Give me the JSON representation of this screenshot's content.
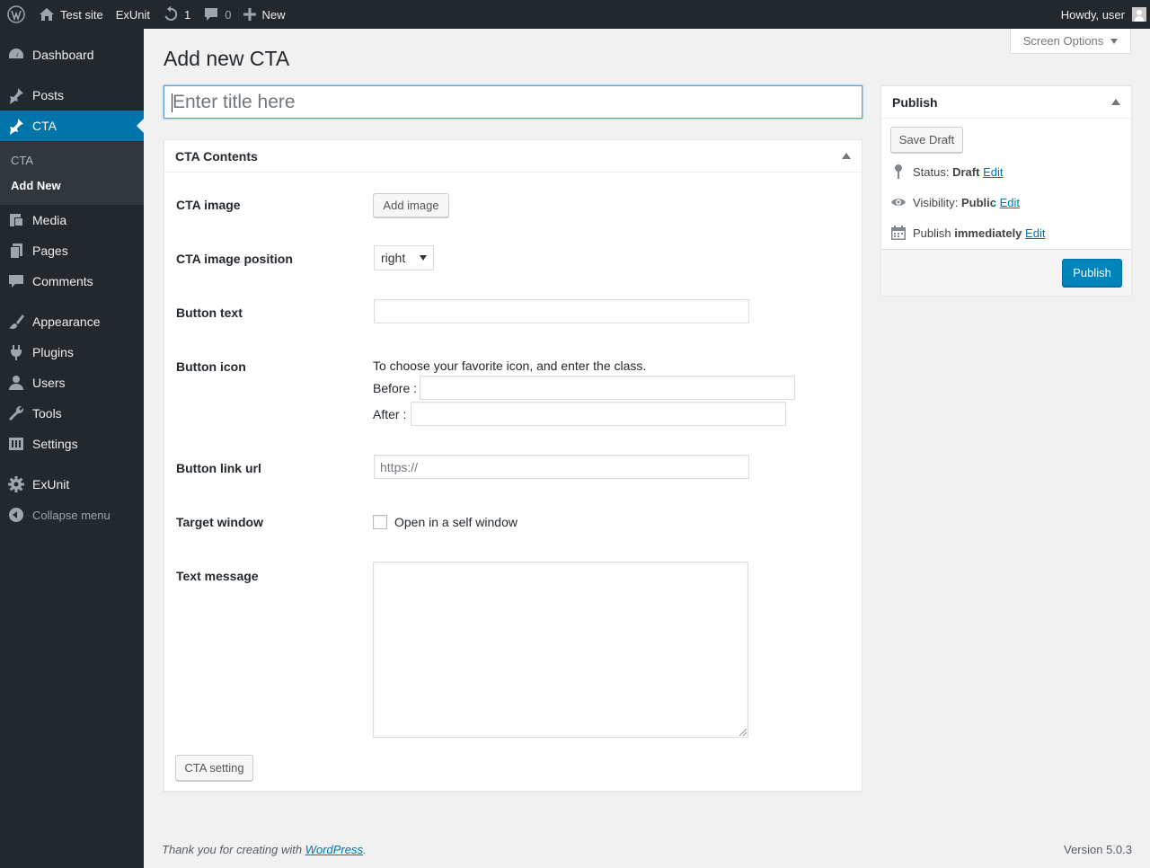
{
  "adminbar": {
    "site_name": "Test site",
    "theme_link": "ExUnit",
    "updates_count": "1",
    "comments_count": "0",
    "new_label": "New",
    "greeting": "Howdy, user"
  },
  "sidebar": {
    "items": [
      {
        "label": "Dashboard"
      },
      {
        "label": "Posts"
      },
      {
        "label": "CTA"
      },
      {
        "label": "Media"
      },
      {
        "label": "Pages"
      },
      {
        "label": "Comments"
      },
      {
        "label": "Appearance"
      },
      {
        "label": "Plugins"
      },
      {
        "label": "Users"
      },
      {
        "label": "Tools"
      },
      {
        "label": "Settings"
      },
      {
        "label": "ExUnit"
      }
    ],
    "submenu": [
      "CTA",
      "Add New"
    ],
    "collapse_label": "Collapse menu"
  },
  "screen_options_label": "Screen Options",
  "page_title": "Add new CTA",
  "title_placeholder": "Enter title here",
  "cta_box": {
    "heading": "CTA Contents",
    "image_label": "CTA image",
    "add_image_button": "Add image",
    "image_position_label": "CTA image position",
    "image_position_value": "right",
    "button_text_label": "Button text",
    "button_text_value": "",
    "button_icon_label": "Button icon",
    "button_icon_help": "To choose your favorite icon, and enter the class.",
    "before_label": "Before :",
    "after_label": "After :",
    "link_url_label": "Button link url",
    "link_url_placeholder": "https://",
    "target_window_label": "Target window",
    "target_window_checkbox": "Open in a self window",
    "text_message_label": "Text message",
    "cta_setting_button": "CTA setting"
  },
  "publish_box": {
    "heading": "Publish",
    "save_draft": "Save Draft",
    "status_label": "Status:",
    "status_value": "Draft",
    "visibility_label": "Visibility:",
    "visibility_value": "Public",
    "publish_label": "Publish",
    "publish_value": "immediately",
    "edit_link": "Edit",
    "publish_button": "Publish"
  },
  "footer": {
    "thanks_text": "Thank you for creating with",
    "wordpress_link": "WordPress",
    "version": "Version 5.0.3"
  }
}
